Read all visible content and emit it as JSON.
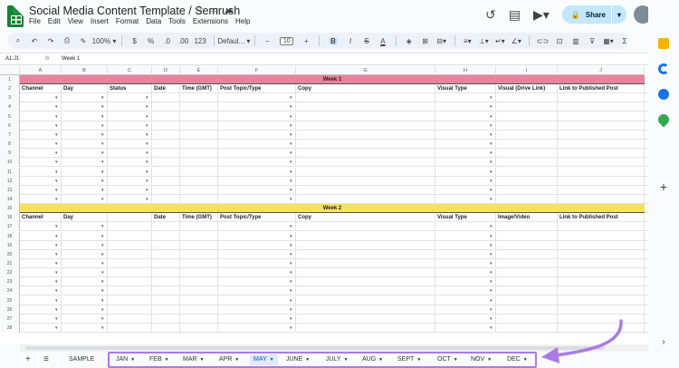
{
  "app": {
    "title": "Social Media Content Template / Semrush",
    "menu": [
      "File",
      "Edit",
      "View",
      "Insert",
      "Format",
      "Data",
      "Tools",
      "Extensions",
      "Help"
    ],
    "share_label": "Share"
  },
  "toolbar": {
    "zoom": "100%",
    "currency": "$",
    "percent": "%",
    "dec_dec": ".0",
    "dec_inc": ".00",
    "format": "123",
    "font": "Defaul...",
    "minus": "−",
    "font_size": "10",
    "plus": "+",
    "bold": "B",
    "italic": "I",
    "strike": "S",
    "text_color": "A",
    "sum": "Σ"
  },
  "formula": {
    "namebox": "A1:J1",
    "fx": "fx",
    "value": "Week 1"
  },
  "grid": {
    "columns": [
      "A",
      "B",
      "C",
      "D",
      "E",
      "F",
      "G",
      "H",
      "I",
      "J"
    ],
    "week1_label": "Week 1",
    "week2_label": "Week 2",
    "week1_headers": [
      "Channel",
      "Day",
      "Status",
      "Date",
      "Time (GMT)",
      "Post Topic/Type",
      "Copy",
      "Visual Type",
      "Visual (Drive Link)",
      "Link to Published Post"
    ],
    "week2_headers": [
      "Channel",
      "Day",
      "",
      "Date",
      "Time (GMT)",
      "Post Topic/Type",
      "Copy",
      "Visual Type",
      "Image/Video",
      "Link to Published Post"
    ],
    "row_numbers": [
      "1",
      "2",
      "3",
      "4",
      "5",
      "6",
      "7",
      "8",
      "9",
      "10",
      "11",
      "12",
      "13",
      "14",
      "15",
      "16",
      "17",
      "18",
      "19",
      "20",
      "21",
      "22",
      "23",
      "24",
      "25",
      "26",
      "27",
      "28"
    ],
    "colors": {
      "week1_band": "#e8839b",
      "week2_band": "#f6e25a"
    }
  },
  "tabs": {
    "add": "+",
    "list": "≡",
    "items": [
      "SAMPLE",
      "JAN",
      "FEB",
      "MAR",
      "APR",
      "MAY",
      "JUNE",
      "JULY",
      "AUG",
      "SEPT",
      "OCT",
      "NOV",
      "DEC"
    ],
    "active": "MAY"
  },
  "annotation": {
    "color": "#a97be8"
  }
}
